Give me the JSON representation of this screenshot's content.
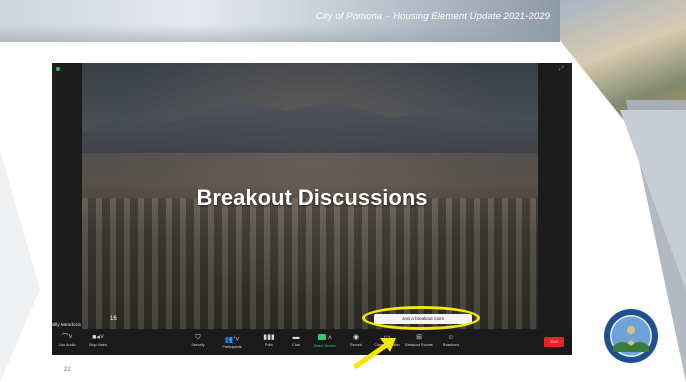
{
  "slide": {
    "header_title": "City of Pomona – Housing Element Update 2021-2029",
    "page_number": "22"
  },
  "zoom": {
    "meeting_title": "Breakout Discussions",
    "tile_number": "16",
    "participant_name": "Milly Mendoza",
    "tooltip": "Join a breakout room",
    "end_label": "End",
    "toolbar": [
      {
        "id": "join-audio",
        "label": "Join Audio",
        "icon": "headphones-icon"
      },
      {
        "id": "stop-video",
        "label": "Stop Video",
        "icon": "video-camera-icon"
      },
      {
        "id": "security",
        "label": "Security",
        "icon": "shield-icon"
      },
      {
        "id": "participants",
        "label": "Participants",
        "icon": "people-icon",
        "count": "1"
      },
      {
        "id": "polls",
        "label": "Polls",
        "icon": "poll-icon"
      },
      {
        "id": "chat",
        "label": "Chat",
        "icon": "chat-icon"
      },
      {
        "id": "share-screen",
        "label": "Share Screen",
        "icon": "share-screen-icon"
      },
      {
        "id": "record",
        "label": "Record",
        "icon": "record-icon"
      },
      {
        "id": "closed-caption",
        "label": "Closed Caption",
        "icon": "cc-icon"
      },
      {
        "id": "breakout-rooms",
        "label": "Breakout Rooms",
        "icon": "breakout-rooms-icon"
      },
      {
        "id": "reactions",
        "label": "Reactions",
        "icon": "emoji-icon"
      }
    ]
  },
  "seal": {
    "top_text": "CITY OF POMONA",
    "bottom_text": "INCORPORATED JAN 6 1888"
  },
  "colors": {
    "annotation": "#f2e800",
    "share_green": "#2ecc71",
    "end_red": "#e02828",
    "toolbar_bg": "#1a1a1a"
  }
}
